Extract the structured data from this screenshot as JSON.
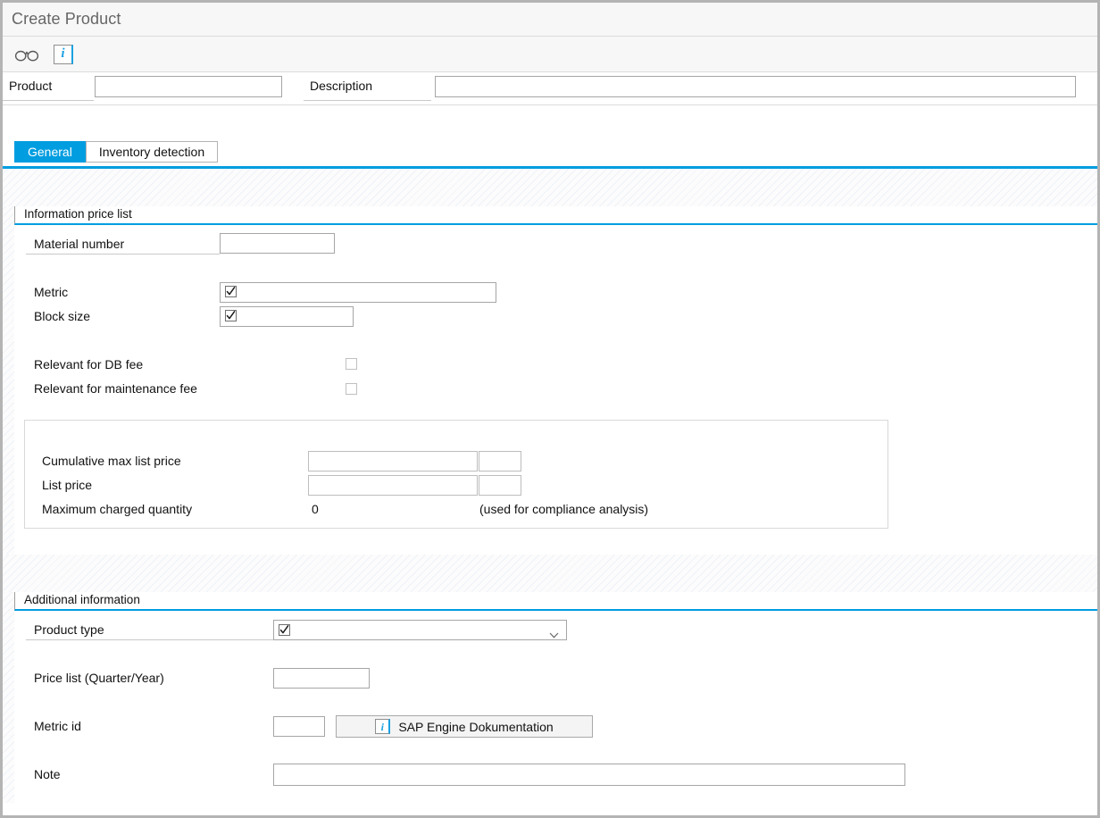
{
  "window": {
    "title": "Create Product"
  },
  "toolbar": {
    "items": [
      {
        "name": "display-glasses-icon",
        "tooltip": "Display"
      },
      {
        "name": "information-icon",
        "label": "i"
      }
    ]
  },
  "header": {
    "product_label": "Product",
    "product_value": "",
    "description_label": "Description",
    "description_value": ""
  },
  "tabs": [
    {
      "label": "General",
      "active": true
    },
    {
      "label": "Inventory detection",
      "active": false
    }
  ],
  "sections": {
    "information_price_list": {
      "title": "Information price list",
      "material_number_label": "Material number",
      "material_number_value": "",
      "metric_label": "Metric",
      "metric_value": "",
      "block_size_label": "Block size",
      "block_size_value": "",
      "relevant_db_fee_label": "Relevant for DB fee",
      "relevant_db_fee_checked": false,
      "relevant_maintenance_fee_label": "Relevant for maintenance fee",
      "relevant_maintenance_fee_checked": false,
      "cumulative_max_list_price_label": "Cumulative max list price",
      "cumulative_max_list_price_value": "",
      "cumulative_max_list_price_currency": "",
      "list_price_label": "List price",
      "list_price_value": "",
      "list_price_currency": "",
      "maximum_charged_quantity_label": "Maximum charged quantity",
      "maximum_charged_quantity_value": "0",
      "compliance_note": "(used for compliance analysis)"
    },
    "additional_information": {
      "title": "Additional information",
      "product_type_label": "Product type",
      "product_type_value": "",
      "price_list_label": "Price list (Quarter/Year)",
      "price_list_value": "",
      "metric_id_label": "Metric id",
      "metric_id_value": "",
      "sap_engine_button_label": "SAP Engine Dokumentation",
      "sap_engine_button_icon": "i",
      "note_label": "Note",
      "note_value": ""
    }
  },
  "colors": {
    "accent": "#009de0",
    "info_blue": "#1ba1e2",
    "title_gray": "#666666",
    "border_gray": "#b4b4b4"
  }
}
